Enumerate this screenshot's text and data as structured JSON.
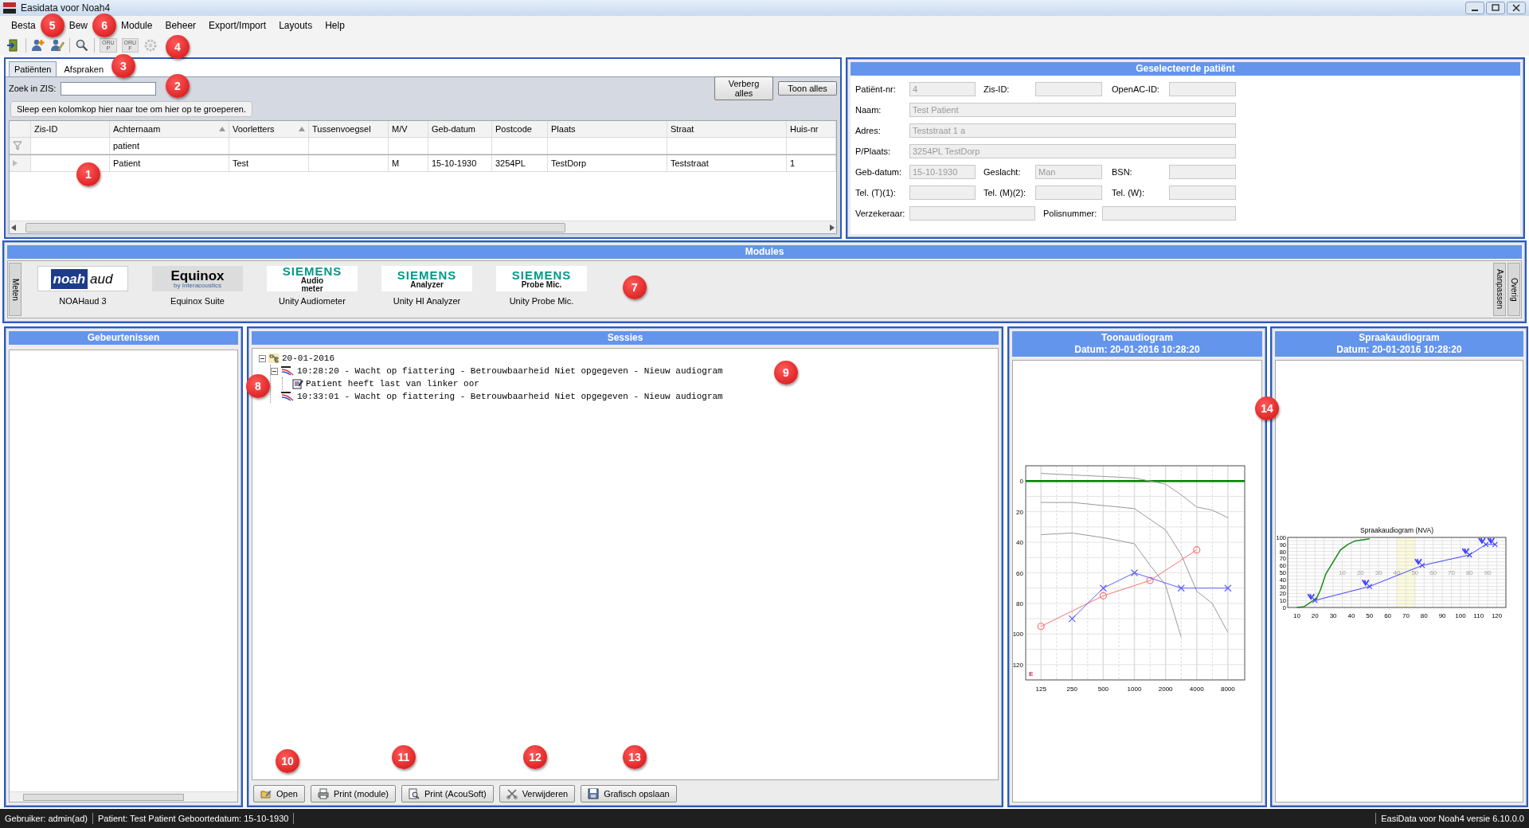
{
  "window": {
    "title": "Easidata voor Noah4"
  },
  "menu": [
    "Besta",
    "Bew",
    "Module",
    "Beheer",
    "Export/Import",
    "Layouts",
    "Help"
  ],
  "toolbar": [
    {
      "kind": "exit",
      "disabled": false
    },
    {
      "kind": "add-user",
      "disabled": false
    },
    {
      "kind": "edit-user",
      "disabled": false
    },
    {
      "kind": "search",
      "disabled": false
    },
    {
      "kind": "oru",
      "top": "ORU",
      "bottom": "P",
      "disabled": true
    },
    {
      "kind": "oru",
      "top": "ORU",
      "bottom": "F",
      "disabled": true
    },
    {
      "kind": "gear",
      "disabled": true
    }
  ],
  "patients": {
    "tabs": [
      {
        "label": "Patiënten",
        "selected": true
      },
      {
        "label": "Afspraken",
        "selected": false
      }
    ],
    "search": {
      "label": "Zoek in ZIS:"
    },
    "buttons": [
      "Verberg alles",
      "Toon alles"
    ],
    "group_hint": "Sleep een kolomkop hier naar toe om hier op te groeperen.",
    "table": {
      "columns": [
        {
          "label": "Zis-ID",
          "sorted": false
        },
        {
          "label": "Achternaam",
          "sorted": true,
          "filter": "patient"
        },
        {
          "label": "Voorletters",
          "sorted": true
        },
        {
          "label": "Tussenvoegsel",
          "sorted": false
        },
        {
          "label": "M/V",
          "sorted": false
        },
        {
          "label": "Geb-datum",
          "sorted": false
        },
        {
          "label": "Postcode",
          "sorted": false
        },
        {
          "label": "Plaats",
          "sorted": false
        },
        {
          "label": "Straat",
          "sorted": false
        },
        {
          "label": "Huis-nr",
          "sorted": false
        }
      ],
      "rows": [
        [
          null,
          "Patient",
          "Test",
          null,
          "M",
          "15-10-1930",
          "3254PL",
          "TestDorp",
          "Teststraat",
          "1"
        ]
      ]
    }
  },
  "selected_patient": {
    "title": "Geselecteerde patiënt",
    "rows": [
      [
        {
          "label": "Patiënt-nr:",
          "value": "4",
          "kind": "short",
          "disabled": true
        },
        {
          "label": "Zis-ID:",
          "kind": "short",
          "disabled": true
        },
        {
          "label": "OpenAC-ID:",
          "kind": "short",
          "disabled": true
        }
      ],
      [
        {
          "label": "Naam:",
          "value": "Test Patient",
          "kind": "wide",
          "disabled": true
        }
      ],
      [
        {
          "label": "Adres:",
          "value": "Teststraat 1 a",
          "kind": "wide",
          "disabled": true
        }
      ],
      [
        {
          "label": "P/Plaats:",
          "value": "3254PL  TestDorp",
          "kind": "wide",
          "disabled": true
        }
      ],
      [
        {
          "label": "Geb-datum:",
          "value": "15-10-1930",
          "kind": "short",
          "disabled": true
        },
        {
          "label": "Geslacht:",
          "value": "Man",
          "kind": "short",
          "disabled": true
        },
        {
          "label": "BSN:",
          "kind": "short",
          "disabled": true
        }
      ],
      [
        {
          "label": "Tel. (T)(1):",
          "kind": "short",
          "disabled": true
        },
        {
          "label": "Tel. (M)(2):",
          "kind": "short",
          "disabled": true
        },
        {
          "label": "Tel. (W):",
          "kind": "short",
          "disabled": true
        }
      ],
      [
        {
          "label": "Verzekeraar:",
          "kind": "half",
          "disabled": true
        },
        {
          "label": "Polisnummer:",
          "kind": "half",
          "disabled": true
        }
      ]
    ]
  },
  "modules": {
    "title": "Modules",
    "side_left": [
      "Meten"
    ],
    "side_right": [
      "Aanpassen",
      "Overig"
    ],
    "items": [
      {
        "name": "NOAHaud 3",
        "kind": "noah",
        "logo": [
          "noah",
          "aud"
        ]
      },
      {
        "name": "Equinox Suite",
        "kind": "equinox",
        "logo": [
          "Equinox",
          "by Interacoustics"
        ]
      },
      {
        "name": "Unity Audiometer",
        "kind": "siemens",
        "logo": [
          "SIEMENS",
          "Audio",
          "meter"
        ]
      },
      {
        "name": "Unity HI Analyzer",
        "kind": "siemens",
        "logo": [
          "SIEMENS",
          "Analyzer"
        ]
      },
      {
        "name": "Unity Probe Mic.",
        "kind": "siemens",
        "logo": [
          "SIEMENS",
          "Probe Mic."
        ]
      }
    ]
  },
  "events": {
    "title": "Gebeurtenissen"
  },
  "sessions": {
    "title": "Sessies",
    "tree": [
      {
        "kind": "date",
        "text": "20-01-2016",
        "expanded": true,
        "children": [
          {
            "kind": "audiogram",
            "text": "10:28:20 - Wacht op fiattering - Betrouwbaarheid Niet opgegeven - Nieuw audiogram",
            "expanded": true,
            "children": [
              {
                "kind": "note",
                "text": "Patient heeft last van linker oor"
              }
            ]
          },
          {
            "kind": "audiogram",
            "text": "10:33:01 - Wacht op fiattering - Betrouwbaarheid Niet opgegeven - Nieuw audiogram"
          }
        ]
      }
    ],
    "buttons": [
      {
        "kind": "open",
        "label": "Open"
      },
      {
        "kind": "print",
        "label": "Print (module)"
      },
      {
        "kind": "preview",
        "label": "Print (AcouSoft)"
      },
      {
        "kind": "delete",
        "label": "Verwijderen"
      },
      {
        "kind": "save",
        "label": "Grafisch opslaan"
      }
    ]
  },
  "tone": {
    "title": "Toonaudiogram",
    "subtitle": "Datum: 20-01-2016 10:28:20",
    "chart_data": {
      "type": "line",
      "grid": true,
      "categories": [
        "125",
        null,
        "250",
        null,
        "500",
        null,
        "1000",
        null,
        "2000",
        null,
        "4000",
        null,
        "8000"
      ],
      "yticks": [
        0,
        20,
        40,
        60,
        80,
        100,
        120
      ],
      "ylim": [
        130,
        -10
      ],
      "ref_lines": [
        {
          "axis": "y",
          "value": 0,
          "color": "#008000"
        }
      ],
      "series": [
        {
          "color": "#999999",
          "marker": "none",
          "values": [
            -5,
            -4.5,
            -4,
            -3.5,
            -3,
            -2.5,
            -2,
            0,
            2,
            9,
            17,
            19,
            24
          ]
        },
        {
          "color": "#999999",
          "marker": "none",
          "values": [
            14,
            14,
            14,
            15,
            16,
            17,
            18,
            25,
            32,
            48,
            72,
            80,
            99
          ]
        },
        {
          "color": "#999999",
          "marker": "none",
          "values": [
            35,
            34.5,
            34,
            35.5,
            37,
            39,
            41,
            55,
            68,
            102,
            null,
            null,
            null
          ]
        },
        {
          "color": "#ff7070",
          "marker": "circle",
          "values": [
            95,
            null,
            null,
            null,
            75,
            null,
            null,
            65,
            null,
            null,
            45,
            null,
            null
          ]
        },
        {
          "color": "#6060ff",
          "marker": "cross",
          "values": [
            null,
            null,
            90,
            null,
            70,
            null,
            60,
            null,
            null,
            70,
            null,
            null,
            70
          ]
        }
      ],
      "annotations": [
        "E"
      ]
    }
  },
  "speech": {
    "title": "Spraakaudiogram",
    "subtitle": "Datum: 20-01-2016 10:28:20",
    "chart_data": {
      "type": "line",
      "title": "Spraakaudiogram (NVA)",
      "grid": true,
      "xticks": [
        10,
        20,
        30,
        40,
        50,
        60,
        70,
        80,
        90,
        100,
        110,
        120
      ],
      "yticks": [
        0,
        10,
        20,
        30,
        40,
        50,
        60,
        70,
        80,
        90,
        100
      ],
      "xlim": [
        5,
        125
      ],
      "ylim": [
        0,
        100
      ],
      "series": [
        {
          "color": "#1a8a1a",
          "marker": "none",
          "x": [
            10,
            14,
            18,
            21,
            23,
            26,
            34,
            38,
            42,
            50
          ],
          "values": [
            0,
            1,
            8,
            14,
            25,
            48,
            82,
            90,
            95,
            98
          ]
        },
        {
          "color": "#4040ff",
          "marker": "cross",
          "x": [
            20,
            50,
            79,
            105,
            114,
            119
          ],
          "values": [
            10,
            30,
            60,
            75,
            90,
            90
          ]
        }
      ],
      "bands": [
        {
          "axis": "x",
          "from": 65,
          "to": 75,
          "color": "#fdfbd8"
        }
      ],
      "annotations": [
        "10",
        "20",
        "30",
        "40",
        "50",
        "60",
        "70",
        "80",
        "90"
      ]
    }
  },
  "status_bar": [
    "Gebruiker: admin(ad)",
    "Patient: Test Patient Geboortedatum: 15-10-1930",
    "EasiData voor Noah4 versie 6.10.0.0"
  ],
  "callouts": [
    "1",
    "2",
    "3",
    "4",
    "5",
    "6",
    "7",
    "8",
    "9",
    "10",
    "11",
    "12",
    "13",
    "14"
  ]
}
